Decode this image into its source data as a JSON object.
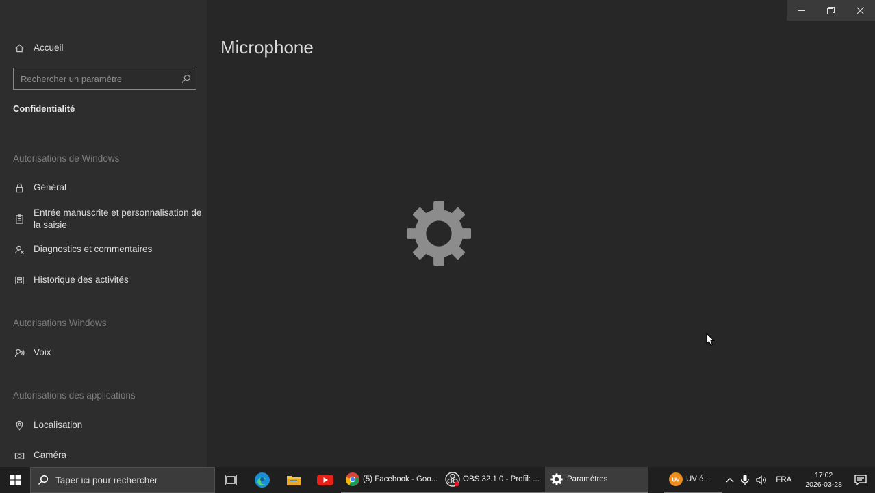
{
  "window": {
    "minimize_icon": "minimize-icon",
    "restore_icon": "restore-icon",
    "close_icon": "close-icon"
  },
  "sidebar": {
    "home_label": "Accueil",
    "search_placeholder": "Rechercher un paramètre",
    "section_title": "Confidentialité",
    "groups": [
      {
        "heading": "Autorisations de Windows",
        "items": [
          {
            "label": "Général",
            "icon": "lock-icon"
          },
          {
            "label": "Entrée manuscrite et personnalisation de",
            "label2": "la saisie",
            "icon": "clipboard-icon"
          },
          {
            "label": "Diagnostics et commentaires",
            "icon": "feedback-icon"
          },
          {
            "label": "Historique des activités",
            "icon": "timeline-icon"
          }
        ]
      },
      {
        "heading": "Autorisations Windows",
        "items": [
          {
            "label": "Voix",
            "icon": "voice-icon"
          }
        ]
      },
      {
        "heading": "Autorisations des applications",
        "items": [
          {
            "label": "Localisation",
            "icon": "location-icon"
          },
          {
            "label": "Caméra",
            "icon": "camera-icon"
          }
        ]
      }
    ]
  },
  "main": {
    "title": "Microphone",
    "loading_icon": "loading-gear-icon"
  },
  "taskbar": {
    "search_text": "Taper ici pour rechercher",
    "apps": [
      {
        "label": "(5) Facebook - Goo...",
        "icon": "chrome-icon"
      },
      {
        "label": "OBS 32.1.0 - Profil: ...",
        "icon": "obs-icon"
      },
      {
        "label": "Paramètres",
        "icon": "settings-icon"
      },
      {
        "label": "UV é...",
        "icon": "uv-icon"
      }
    ],
    "language": "FRA",
    "time": "17:02",
    "date": "2026-03-28"
  },
  "colors": {
    "sidebar_bg": "#2d2d2d",
    "main_bg": "#272727",
    "taskbar_bg": "#1f1f1f",
    "spinner": "#8c8c8c"
  }
}
